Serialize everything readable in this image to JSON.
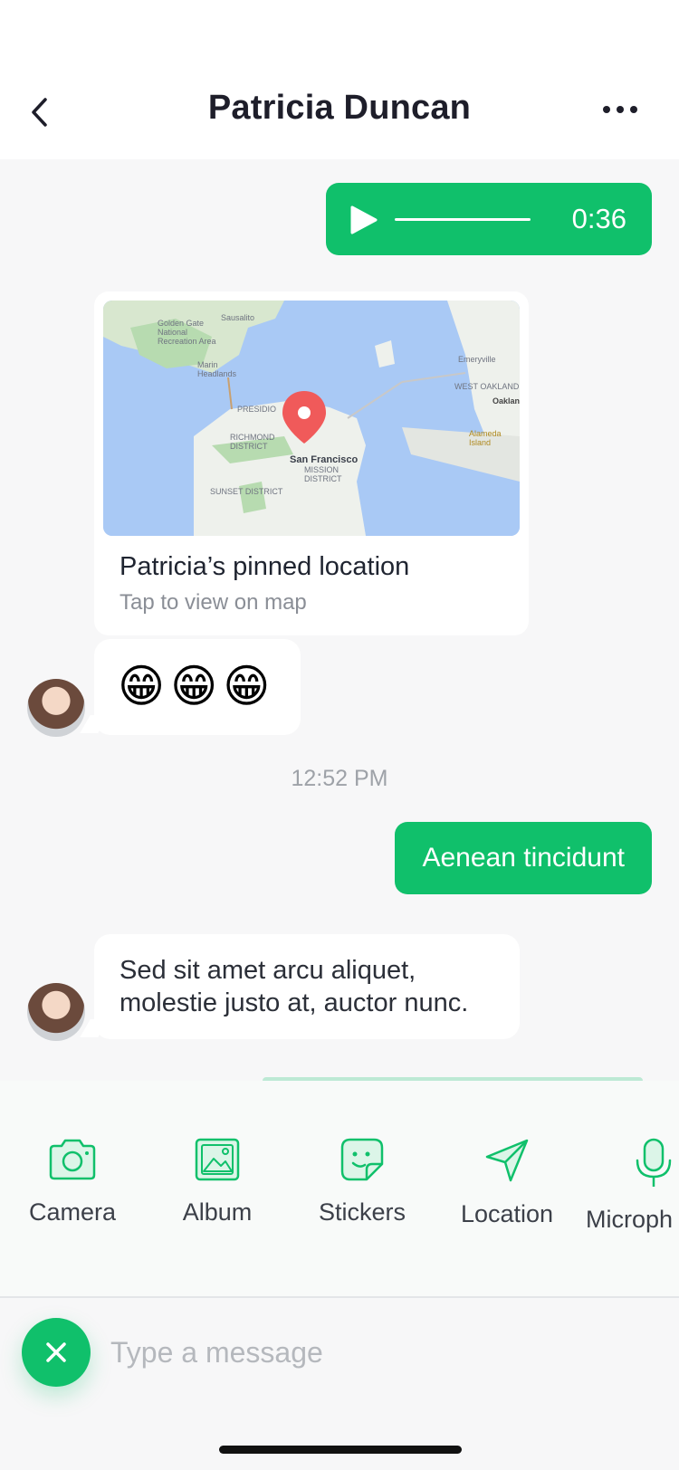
{
  "header": {
    "title": "Patricia Duncan"
  },
  "audio_message": {
    "duration": "0:36"
  },
  "location_card": {
    "title": "Patricia’s pinned location",
    "subtitle": "Tap to view on map",
    "map_labels": {
      "city": "San Francisco",
      "sausalito": "Sausalito",
      "golden_gate": "Golden Gate National Recreation Area",
      "marin": "Marin Headlands",
      "oakland": "Oaklan",
      "emeryville": "Emeryville",
      "west_oakland": "WEST OAKLAND",
      "richmond": "RICHMOND DISTRICT",
      "mission": "MISSION DISTRICT",
      "sunset": "SUNSET DISTRICT",
      "presidio": "PRESIDIO",
      "alameda": "Alameda Island"
    }
  },
  "emoji_message": {
    "text": "😁😁😁"
  },
  "timestamp": "12:52 PM",
  "sent_message": {
    "text": "Aenean tincidunt"
  },
  "received_message": {
    "text": "Sed sit amet arcu aliquet, molestie justo at, auctor nunc."
  },
  "tray": {
    "items": [
      {
        "label": "Camera",
        "icon": "camera-icon"
      },
      {
        "label": "Album",
        "icon": "image-icon"
      },
      {
        "label": "Stickers",
        "icon": "sticker-icon"
      },
      {
        "label": "Location",
        "icon": "location-arrow-icon"
      },
      {
        "label": "Microph",
        "icon": "microphone-icon"
      }
    ]
  },
  "composer": {
    "placeholder": "Type a message"
  },
  "colors": {
    "accent": "#10c06b",
    "background": "#f7f7f8",
    "text": "#1e1e2a"
  }
}
